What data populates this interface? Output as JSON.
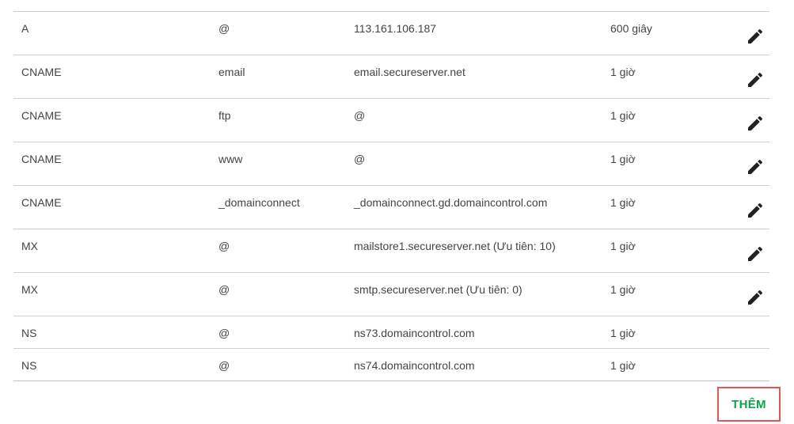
{
  "records": [
    {
      "type": "A",
      "host": "@",
      "value": "113.161.106.187",
      "ttl": "600 giây",
      "editable": true
    },
    {
      "type": "CNAME",
      "host": "email",
      "value": "email.secureserver.net",
      "ttl": "1 giờ",
      "editable": true
    },
    {
      "type": "CNAME",
      "host": "ftp",
      "value": "@",
      "ttl": "1 giờ",
      "editable": true
    },
    {
      "type": "CNAME",
      "host": "www",
      "value": "@",
      "ttl": "1 giờ",
      "editable": true
    },
    {
      "type": "CNAME",
      "host": "_domainconnect",
      "value": "_domainconnect.gd.domaincontrol.com",
      "ttl": "1 giờ",
      "editable": true
    },
    {
      "type": "MX",
      "host": "@",
      "value": "mailstore1.secureserver.net (Ưu tiên: 10)",
      "ttl": "1 giờ",
      "editable": true
    },
    {
      "type": "MX",
      "host": "@",
      "value": "smtp.secureserver.net (Ưu tiên: 0)",
      "ttl": "1 giờ",
      "editable": true
    },
    {
      "type": "NS",
      "host": "@",
      "value": "ns73.domaincontrol.com",
      "ttl": "1 giờ",
      "editable": false
    },
    {
      "type": "NS",
      "host": "@",
      "value": "ns74.domaincontrol.com",
      "ttl": "1 giờ",
      "editable": false
    }
  ],
  "icons": {
    "edit": "pencil-icon"
  },
  "actions": {
    "add_label": "THÊM"
  },
  "colors": {
    "add_text": "#0ea04c",
    "highlight_border": "#e05757",
    "row_divider": "#d0d0d0"
  }
}
